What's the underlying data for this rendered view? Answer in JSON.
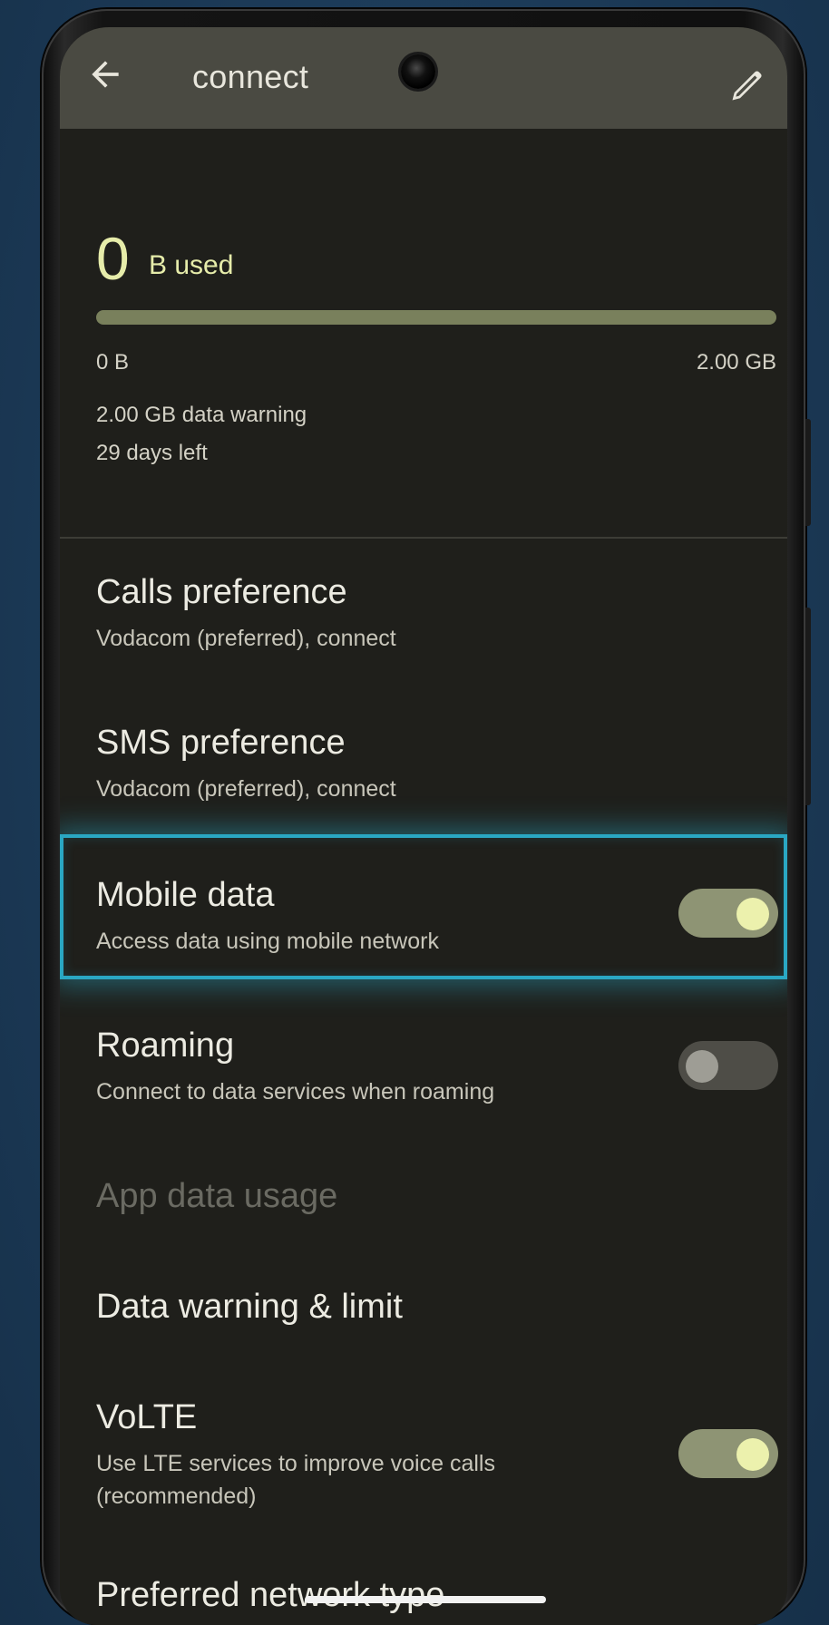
{
  "appbar": {
    "title": "connect",
    "back_icon": "arrow-back-icon",
    "edit_icon": "pencil-edit-icon"
  },
  "usage": {
    "amount": "0",
    "unit_label": "B used",
    "progress_fraction": 0,
    "scale_min": "0 B",
    "scale_max": "2.00 GB",
    "warning": "2.00 GB data warning",
    "days_left": "29 days left"
  },
  "settings": {
    "calls": {
      "title": "Calls preference",
      "subtitle": "Vodacom (preferred), connect"
    },
    "sms": {
      "title": "SMS preference",
      "subtitle": "Vodacom (preferred), connect"
    },
    "mobile_data": {
      "title": "Mobile data",
      "subtitle": "Access data using mobile network",
      "enabled": true
    },
    "roaming": {
      "title": "Roaming",
      "subtitle": "Connect to data services when roaming",
      "enabled": false
    },
    "app_data_usage": {
      "title": "App data usage",
      "disabled": true
    },
    "data_warning": {
      "title": "Data warning & limit"
    },
    "volte": {
      "title": "VoLTE",
      "subtitle_line1": "Use LTE services to improve voice calls",
      "subtitle_line2": "(recommended)",
      "enabled": true
    },
    "preferred_network": {
      "title": "Preferred network type"
    }
  },
  "colors": {
    "accent": "#e6ecaa",
    "highlight": "#2aa7c3",
    "toggle_on_track": "#8e9474",
    "toggle_off_track": "#4e4d47",
    "background": "#1f1f1b",
    "appbar": "#4a4a42"
  }
}
